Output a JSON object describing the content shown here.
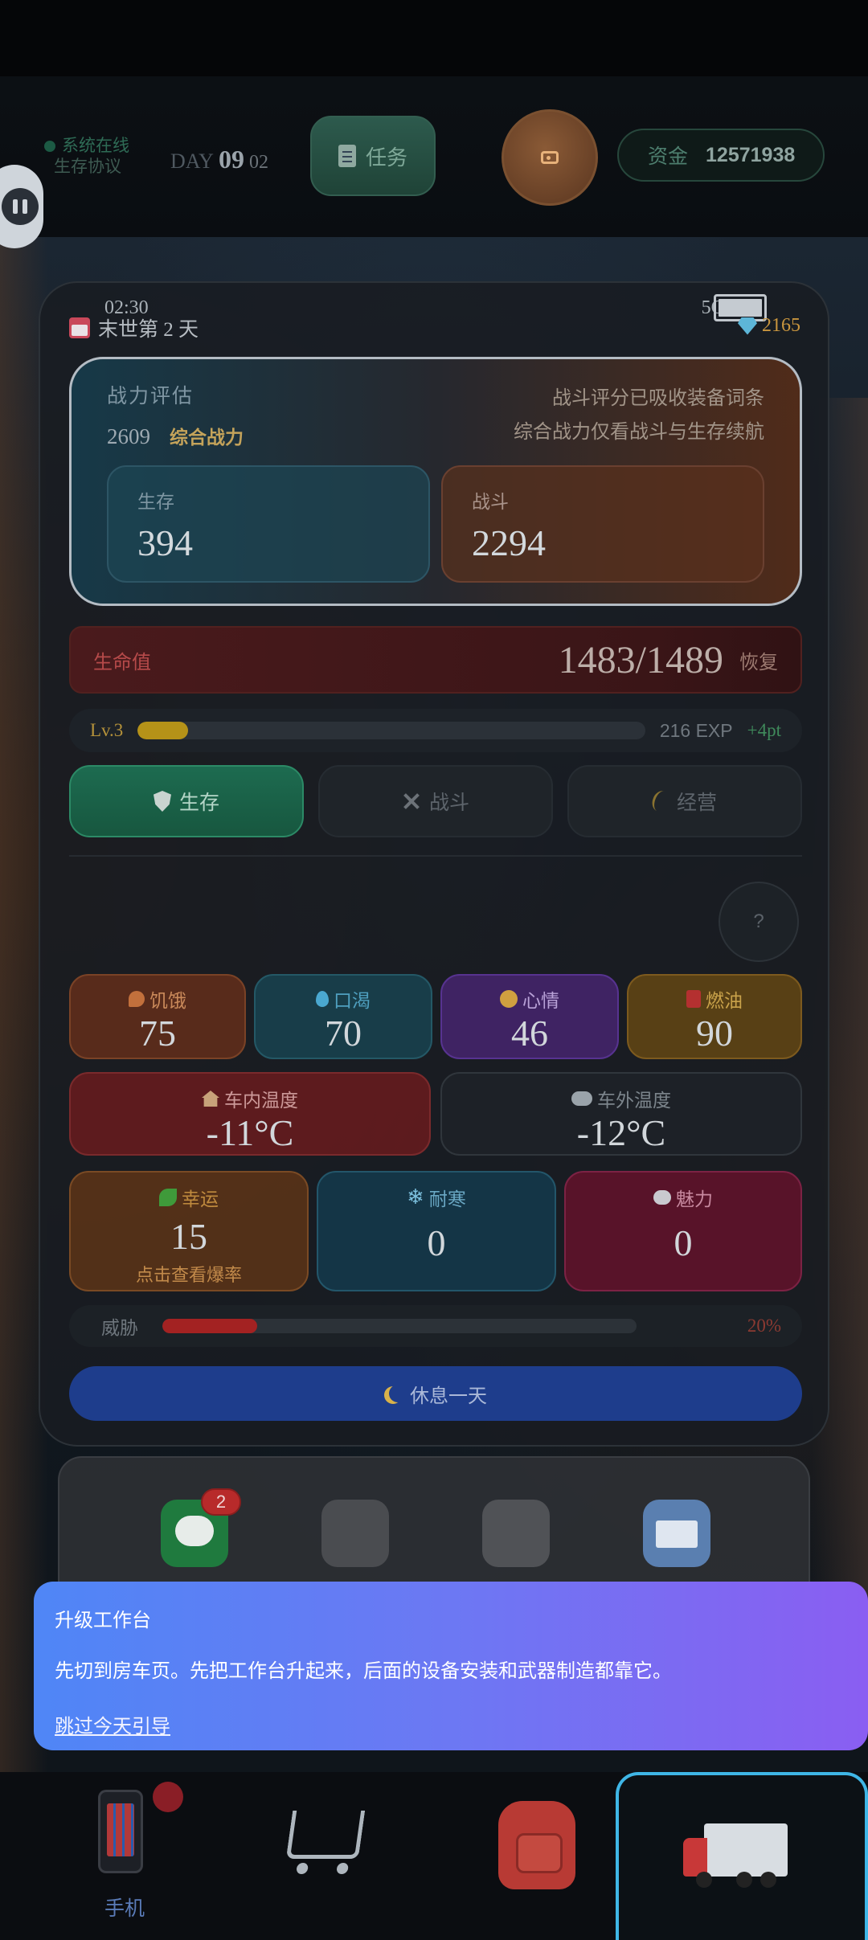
{
  "topbar": {
    "online_status": "系统在线",
    "protocol": "生存协议",
    "day_label": "DAY",
    "day_number": "09",
    "day_sub": "02",
    "task_button": "任务",
    "funds_label": "资金",
    "funds_value": "12571938"
  },
  "phone_status": {
    "time": "02:30",
    "signal": "5G",
    "date_text": "末世第 2 天",
    "gems": "2165"
  },
  "power": {
    "title": "战力评估",
    "score": "2609",
    "score_label": "综合战力",
    "note_line1": "战斗评分已吸收装备词条",
    "note_line2": "综合战力仅看战斗与生存续航",
    "survival_label": "生存",
    "survival_value": "394",
    "combat_label": "战斗",
    "combat_value": "2294"
  },
  "hp": {
    "label": "生命值",
    "value": "1483/1489",
    "recover_button": "恢复"
  },
  "level": {
    "label": "Lv.3",
    "progress": 0.1,
    "exp": "216 EXP",
    "points": "+4pt"
  },
  "tabs": [
    {
      "label": "生存",
      "icon": "shield-icon",
      "active": true
    },
    {
      "label": "战斗",
      "icon": "swords-icon",
      "active": false
    },
    {
      "label": "经营",
      "icon": "wheat-icon",
      "active": false
    }
  ],
  "help_button": "?",
  "stats": {
    "hunger": {
      "label": "饥饿",
      "value": "75"
    },
    "thirst": {
      "label": "口渴",
      "value": "70"
    },
    "mood": {
      "label": "心情",
      "value": "46"
    },
    "fuel": {
      "label": "燃油",
      "value": "90"
    },
    "inside_temp": {
      "label": "车内温度",
      "value": "-11°C"
    },
    "outside_temp": {
      "label": "车外温度",
      "value": "-12°C"
    },
    "luck": {
      "label": "幸运",
      "value": "15",
      "hint": "点击查看爆率"
    },
    "cold_resist": {
      "label": "耐寒",
      "value": "0"
    },
    "charm": {
      "label": "魅力",
      "value": "0"
    }
  },
  "threat": {
    "label": "威胁",
    "progress": 0.2,
    "percent": "20%"
  },
  "rest_button": "休息一天",
  "dock": {
    "message_badge": "2"
  },
  "guide": {
    "title": "升级工作台",
    "message": "先切到房车页。先把工作台升起来，后面的设备安装和武器制造都靠它。",
    "skip": "跳过今天引导"
  },
  "bottom_nav": {
    "phone_label": "手机"
  },
  "colors": {
    "accent_green": "#1d6b50",
    "hp_red": "#b64a4a",
    "gold": "#c8953e",
    "guide_start": "#4f86f6",
    "guide_end": "#8a5ef2",
    "nav_active": "#3fb6e6"
  }
}
